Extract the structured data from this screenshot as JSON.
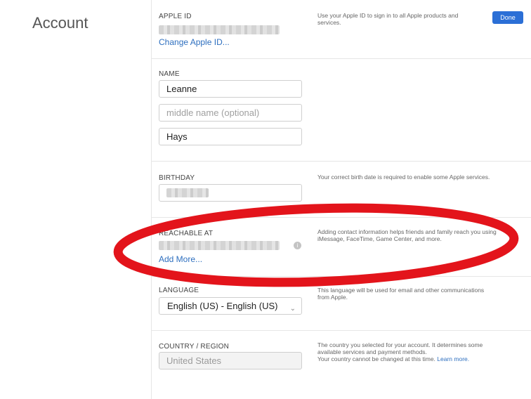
{
  "page": {
    "title": "Account"
  },
  "header": {
    "done_label": "Done"
  },
  "apple_id": {
    "label": "APPLE ID",
    "change_link": "Change Apple ID...",
    "note": "Use your Apple ID to sign in to all Apple products and services."
  },
  "name": {
    "label": "NAME",
    "first": "Leanne",
    "middle_placeholder": "middle name (optional)",
    "last": "Hays"
  },
  "birthday": {
    "label": "BIRTHDAY",
    "note": "Your correct birth date is required to enable some Apple services."
  },
  "reachable": {
    "label": "REACHABLE AT",
    "add_more": "Add More...",
    "note": "Adding contact information helps friends and family reach you using iMessage, FaceTime, Game Center, and more."
  },
  "language": {
    "label": "LANGUAGE",
    "selected": "English (US) - English (US)",
    "note": "This language will be used for email and other communications from Apple."
  },
  "country": {
    "label": "COUNTRY / REGION",
    "value": "United States",
    "note_1": "The country you selected for your account. It determines some available services and payment methods.",
    "note_2": "Your country cannot be changed at this time.",
    "learn_more": "Learn more."
  },
  "annotation": {
    "color": "#e3141b"
  }
}
